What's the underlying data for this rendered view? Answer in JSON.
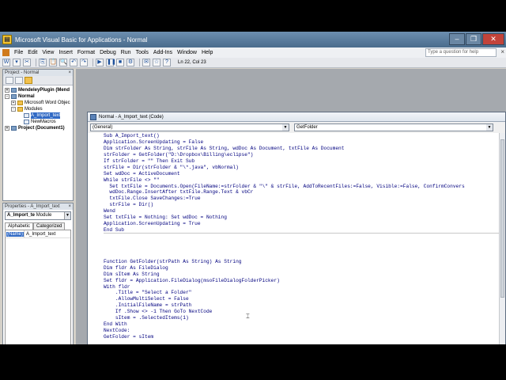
{
  "window": {
    "title": "Microsoft Visual Basic for Applications - Normal",
    "buttons": [
      "–",
      "❐",
      "✕"
    ]
  },
  "menu": {
    "items": [
      "File",
      "Edit",
      "View",
      "Insert",
      "Format",
      "Debug",
      "Run",
      "Tools",
      "Add-Ins",
      "Window",
      "Help"
    ],
    "help_search_placeholder": "Type a question for help",
    "close_glyph": "×"
  },
  "toolbar": {
    "status": "Ln 22, Col 23",
    "buttons": [
      "W",
      "▾",
      "✂",
      "⎘",
      "📋",
      "🔍",
      "↶",
      "↷",
      "▶",
      "❚❚",
      "■",
      "⚙",
      "✉",
      "☆",
      "?"
    ]
  },
  "project_panel": {
    "title": "Project - Normal",
    "tree": [
      {
        "label": "MendeleyPlugin (Mend",
        "indent": 0,
        "exp": "+",
        "icon": "proj",
        "bold": true
      },
      {
        "label": "Normal",
        "indent": 0,
        "exp": "-",
        "icon": "proj",
        "bold": true
      },
      {
        "label": "Microsoft Word Objec",
        "indent": 1,
        "exp": "+",
        "icon": "folder",
        "bold": false
      },
      {
        "label": "Modules",
        "indent": 1,
        "exp": "-",
        "icon": "folder",
        "bold": false
      },
      {
        "label": "A_Import_text",
        "indent": 2,
        "exp": "",
        "icon": "mod",
        "bold": false,
        "selected": true
      },
      {
        "label": "NewMacros",
        "indent": 2,
        "exp": "",
        "icon": "mod",
        "bold": false
      },
      {
        "label": "Project (Document1)",
        "indent": 0,
        "exp": "+",
        "icon": "proj",
        "bold": true
      }
    ]
  },
  "properties_panel": {
    "title": "Properties - A_Import_text",
    "object_name": "A_Import_te",
    "object_type": "Module",
    "tabs": [
      "Alphabetic",
      "Categorized"
    ],
    "rows": [
      {
        "name": "(Name)",
        "value": "A_Import_text"
      }
    ]
  },
  "code_window": {
    "title": "Normal - A_Import_text (Code)",
    "object_dropdown": "(General)",
    "procedure_dropdown": "GetFolder",
    "lines": [
      "Sub A_Import_text()",
      "Application.ScreenUpdating = False",
      "Dim strFolder As String, strFile As String, wdDoc As Document, txtFile As Document",
      "strFolder = GetFolder(\"D:\\Dropbox\\Billing\\eclipse\")",
      "If strFolder = \"\" Then Exit Sub",
      "strFile = Dir(strFolder & \"\\*.java\", vbNormal)",
      "Set wdDoc = ActiveDocument",
      "While strFile <> \"\"",
      "  Set txtFile = Documents.Open(FileName:=strFolder & \"\\\" & strFile, AddToRecentFiles:=False, Visible:=False, ConfirmConvers",
      "  wdDoc.Range.InsertAfter txtFile.Range.Text & vbCr",
      "  txtFile.Close SaveChanges:=True",
      "  strFile = Dir()",
      "Wend",
      "Set txtFile = Nothing: Set wdDoc = Nothing",
      "Application.ScreenUpdating = True",
      "End Sub",
      "",
      "",
      "",
      "",
      "Function GetFolder(strPath As String) As String",
      "Dim fldr As FileDialog",
      "Dim sItem As String",
      "Set fldr = Application.FileDialog(msoFileDialogFolderPicker)",
      "With fldr",
      "    .Title = \"Select a Folder\"",
      "    .AllowMultiSelect = False",
      "    .InitialFileName = strPath",
      "    If .Show <> -1 Then GoTo NextCode",
      "    sItem = .SelectedItems(1)",
      "End With",
      "NextCode:",
      "GetFolder = sItem"
    ]
  }
}
